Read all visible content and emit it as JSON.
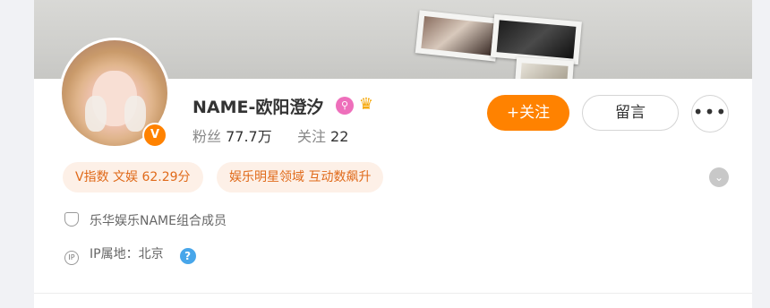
{
  "profile": {
    "name": "NAME-欧阳澄汐",
    "verified_badge": "V",
    "stats": {
      "followers_label": "粉丝",
      "followers_value": "77.7万",
      "following_label": "关注",
      "following_value": "22"
    }
  },
  "actions": {
    "follow_label": "+关注",
    "message_label": "留言",
    "more_label": "•••"
  },
  "tags": [
    {
      "text": "V指数 文娱 62.29分"
    },
    {
      "text": "娱乐明星领域 互动数飙升"
    }
  ],
  "info": {
    "bio": "乐华娱乐NAME组合成员",
    "ip_location": "IP属地：北京",
    "ip_icon_text": "IP",
    "help_icon_text": "?"
  },
  "icons": {
    "pink": "pink-badge-icon",
    "crown": "crown-icon",
    "chevron": "chevron-down-icon",
    "shield": "shield-icon",
    "ip": "ip-icon",
    "help": "help-icon",
    "more": "more-icon"
  },
  "colors": {
    "accent": "#ff8200",
    "tag_bg": "#fdf0e7",
    "tag_text": "#e06a1a",
    "help": "#48a6ea"
  }
}
